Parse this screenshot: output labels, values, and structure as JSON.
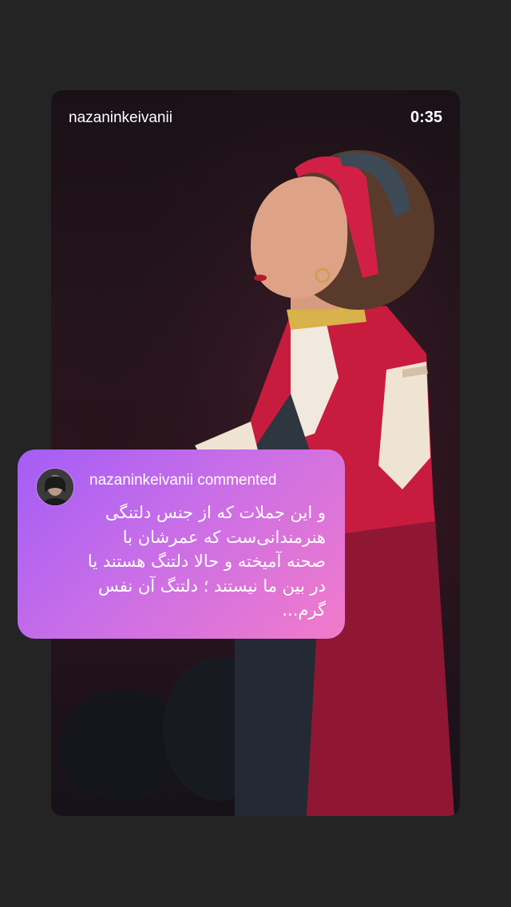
{
  "video": {
    "username": "nazaninkeivanii",
    "time": "0:35"
  },
  "comment": {
    "header": "nazaninkeivanii commented",
    "text": "و این جملات که از جنس دلتنگی هنرمندانی‌ست که عمرشان با صحنه آمیخته و حالا دلتنگ هستند یا در بین ما نیستند ؛ دلتنگ آن نفس گرم..."
  },
  "colors": {
    "background": "#242424",
    "comment_gradient_start": "#a35df5",
    "comment_gradient_end": "#f27bc9"
  }
}
